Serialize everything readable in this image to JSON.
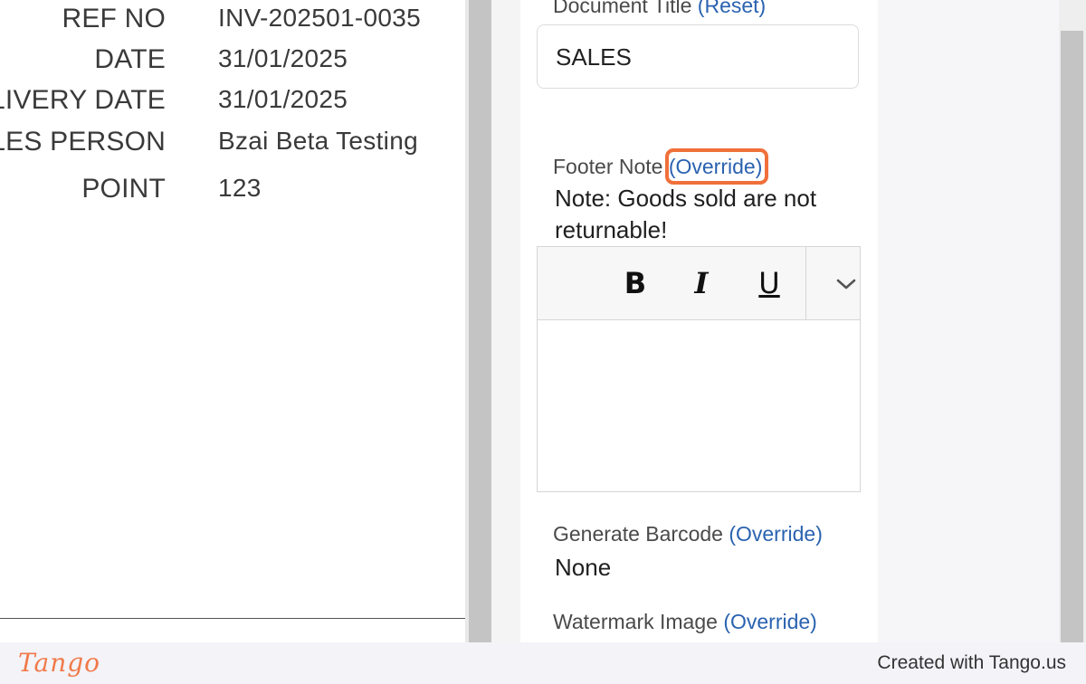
{
  "invoice_preview": {
    "rows": [
      {
        "label": "REF NO",
        "value": "INV-202501-0035"
      },
      {
        "label": "DATE",
        "value": "31/01/2025"
      },
      {
        "label": "LIVERY DATE",
        "value": "31/01/2025"
      },
      {
        "label": "LES PERSON",
        "value": "Bzai Beta Testing"
      },
      {
        "label": "POINT",
        "value": "123"
      }
    ]
  },
  "settings": {
    "document_title": {
      "label": "Document Title",
      "action": "(Reset)",
      "value": "SALES"
    },
    "footer_note": {
      "label": "Footer Note",
      "action": "(Override)",
      "text": "Note: Goods sold are not returnable!",
      "toolbar": {
        "bold": "B",
        "italic": "I",
        "underline": "U"
      },
      "editor_value": ""
    },
    "generate_barcode": {
      "label": "Generate Barcode",
      "action": "(Override)",
      "value": "None"
    },
    "watermark_image": {
      "label": "Watermark Image",
      "action": "(Override)"
    }
  },
  "footer": {
    "logo": "Tango",
    "credit": "Created with Tango.us"
  },
  "colors": {
    "link": "#2a62b0",
    "highlight": "#f07a4a"
  },
  "icons": {
    "more": "chevron-down-icon"
  }
}
